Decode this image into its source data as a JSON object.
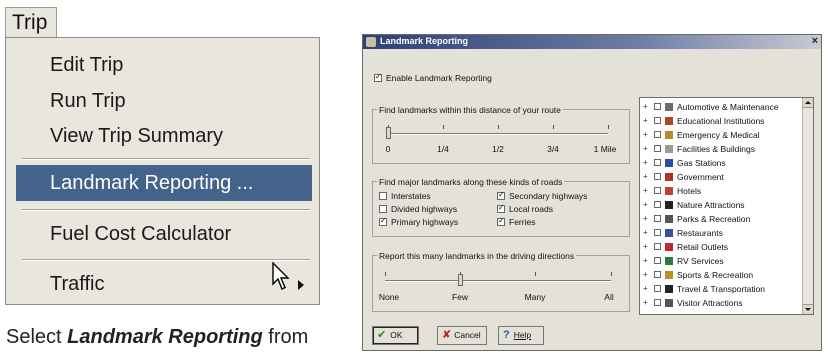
{
  "menu": {
    "title": "Trip",
    "items": [
      {
        "label": "Edit Trip"
      },
      {
        "label": "Run Trip"
      },
      {
        "label": "View Trip Summary"
      },
      {
        "label": "Landmark Reporting ...",
        "selected": true
      },
      {
        "label": "Fuel Cost Calculator"
      },
      {
        "label": "Traffic",
        "has_submenu": true
      }
    ],
    "selected_color": "#44638a"
  },
  "caption": {
    "prefix": "Select ",
    "emphasis": "Landmark Reporting",
    "suffix": " from"
  },
  "dialog": {
    "title": "Landmark Reporting",
    "enable_label": "Enable Landmark Reporting",
    "enable_checked": true,
    "distance": {
      "label": "Find landmarks within this distance of your route",
      "ticks": [
        "0",
        "1/4",
        "1/2",
        "3/4",
        "1 Mile"
      ],
      "selected_index": 0
    },
    "roads": {
      "label": "Find major landmarks along these kinds of roads",
      "options": [
        {
          "label": "Interstates",
          "checked": false
        },
        {
          "label": "Secondary highways",
          "checked": true
        },
        {
          "label": "Divided highways",
          "checked": false
        },
        {
          "label": "Local roads",
          "checked": true
        },
        {
          "label": "Primary highways",
          "checked": true
        },
        {
          "label": "Ferries",
          "checked": true
        }
      ]
    },
    "report": {
      "label": "Report this many landmarks in the driving directions",
      "ticks": [
        "None",
        "Few",
        "Many",
        "All"
      ],
      "selected_index": 1
    },
    "categories": [
      {
        "label": "Automotive & Maintenance",
        "icon": "car-icon",
        "color": "#6b6b6b"
      },
      {
        "label": "Educational Institutions",
        "icon": "school-icon",
        "color": "#b0452a"
      },
      {
        "label": "Emergency & Medical",
        "icon": "medical-icon",
        "color": "#b88a2a"
      },
      {
        "label": "Facilities & Buildings",
        "icon": "building-icon",
        "color": "#9a9a9a"
      },
      {
        "label": "Gas Stations",
        "icon": "gas-icon",
        "color": "#2a4da0"
      },
      {
        "label": "Government",
        "icon": "government-icon",
        "color": "#b0302a"
      },
      {
        "label": "Hotels",
        "icon": "hotel-icon",
        "color": "#c0402a"
      },
      {
        "label": "Nature Attractions",
        "icon": "tree-icon",
        "color": "#222222"
      },
      {
        "label": "Parks & Recreation",
        "icon": "park-icon",
        "color": "#555555"
      },
      {
        "label": "Restaurants",
        "icon": "restaurant-icon",
        "color": "#3a50a0"
      },
      {
        "label": "Retail Outlets",
        "icon": "retail-icon",
        "color": "#c02a2a"
      },
      {
        "label": "RV Services",
        "icon": "rv-icon",
        "color": "#2a7a3a"
      },
      {
        "label": "Sports & Recreation",
        "icon": "sports-icon",
        "color": "#b8902a"
      },
      {
        "label": "Travel & Transportation",
        "icon": "plane-icon",
        "color": "#222222"
      },
      {
        "label": "Visitor Attractions",
        "icon": "visitor-icon",
        "color": "#555555"
      }
    ],
    "buttons": {
      "ok": "OK",
      "cancel": "Cancel",
      "help": "Help"
    }
  }
}
